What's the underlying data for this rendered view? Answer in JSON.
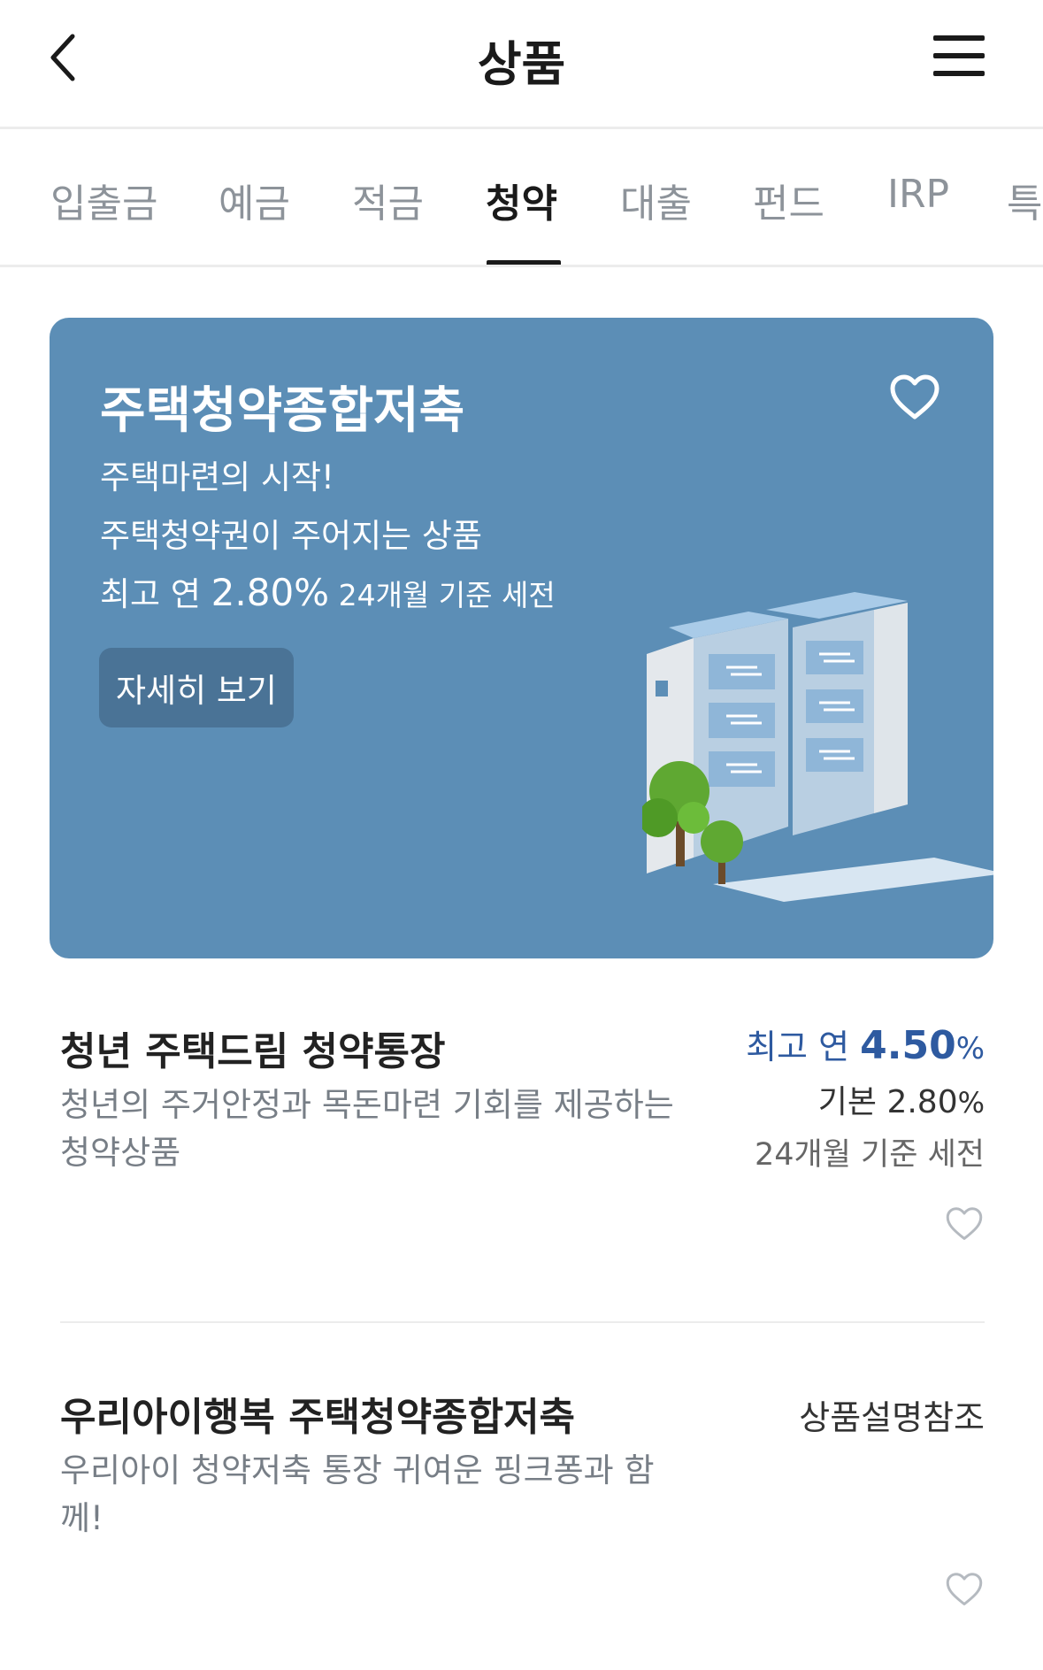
{
  "header": {
    "title": "상품"
  },
  "tabs": [
    {
      "label": "입출금"
    },
    {
      "label": "예금"
    },
    {
      "label": "적금"
    },
    {
      "label": "청약"
    },
    {
      "label": "대출"
    },
    {
      "label": "펀드"
    },
    {
      "label": "IRP"
    },
    {
      "label": "특"
    }
  ],
  "banner": {
    "title": "주택청약종합저축",
    "line1": "주택마련의 시작!",
    "line2": "주택청약권이 주어지는 상품",
    "rate_prefix": "최고 연 ",
    "rate_value": "2.80%",
    "rate_suffix": " 24개월 기준 세전",
    "button": "자세히 보기",
    "bg_color": "#5c8eb6"
  },
  "products": [
    {
      "name": "청년 주택드림 청약통장",
      "desc_line1": "청년의 주거안정과 목돈마련 기회를 제공하는",
      "desc_line2": "청약상품",
      "max_label": "최고 연 ",
      "max_value": "4.50",
      "max_unit": "%",
      "base_label": "기본 ",
      "base_value": "2.80",
      "base_unit": "%",
      "condition": "24개월 기준 세전"
    },
    {
      "name": "우리아이행복 주택청약종합저축",
      "desc_line1": "우리아이 청약저축 통장 귀여운 핑크퐁과 함",
      "desc_line2": "께!",
      "rate_note": "상품설명참조"
    }
  ],
  "icons": {
    "back": "chevron-left-icon",
    "menu": "hamburger-menu-icon",
    "favorite": "heart-outline-icon"
  },
  "colors": {
    "accent": "#2e5aa0",
    "tab_inactive": "#8d939a"
  }
}
